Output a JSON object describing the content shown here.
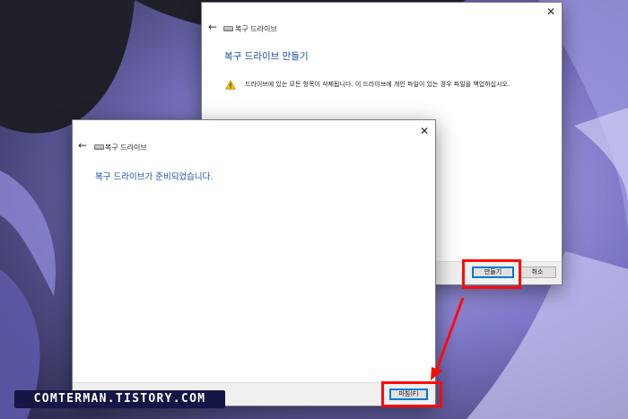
{
  "back_dialog": {
    "title": "복구 드라이브",
    "heading": "복구 드라이브 만들기",
    "warning": "드라이브에 있는 모든 항목이 삭제됩니다. 이 드라이브에 개인 파일이 있는 경우 파일을 백업하십시오.",
    "create_label": "만들기",
    "cancel_label": "취소"
  },
  "front_dialog": {
    "title": "복구 드라이브",
    "heading": "복구 드라이브가 준비되었습니다.",
    "finish_label": "마침(F)"
  },
  "watermark": "COMTERMAN.TISTORY.COM",
  "colors": {
    "accent_heading": "#1c4aa6",
    "highlight": "#ff0a0a",
    "watermark_bg": "#161646"
  }
}
